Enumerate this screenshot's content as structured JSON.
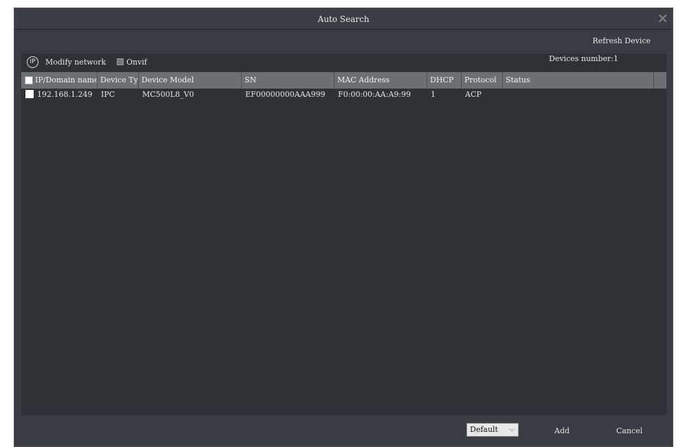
{
  "window": {
    "title": "Auto Search",
    "close_icon": "close-icon"
  },
  "toolbar": {
    "refresh_label": "Refresh Device",
    "modify_network_label": "Modify network",
    "ip_icon_text": "IP",
    "onvif_label": "Onvif",
    "onvif_checked": false,
    "devices_number": "Devices number:1"
  },
  "table": {
    "columns": [
      "IP/Domain name",
      "Device Ty",
      "Device Model",
      "SN",
      "MAC Address",
      "DHCP",
      "Protocol",
      "Status"
    ],
    "rows": [
      {
        "ip": "192.168.1.249",
        "type": "IPC",
        "model": "MC500L8_V0",
        "sn": "EF00000000AAA999",
        "mac": "F0:00:00:AA:A9:99",
        "dhcp": "1",
        "protocol": "ACP",
        "status": ""
      }
    ]
  },
  "footer": {
    "mode_select": "Default",
    "add_label": "Add",
    "cancel_label": "Cancel"
  }
}
